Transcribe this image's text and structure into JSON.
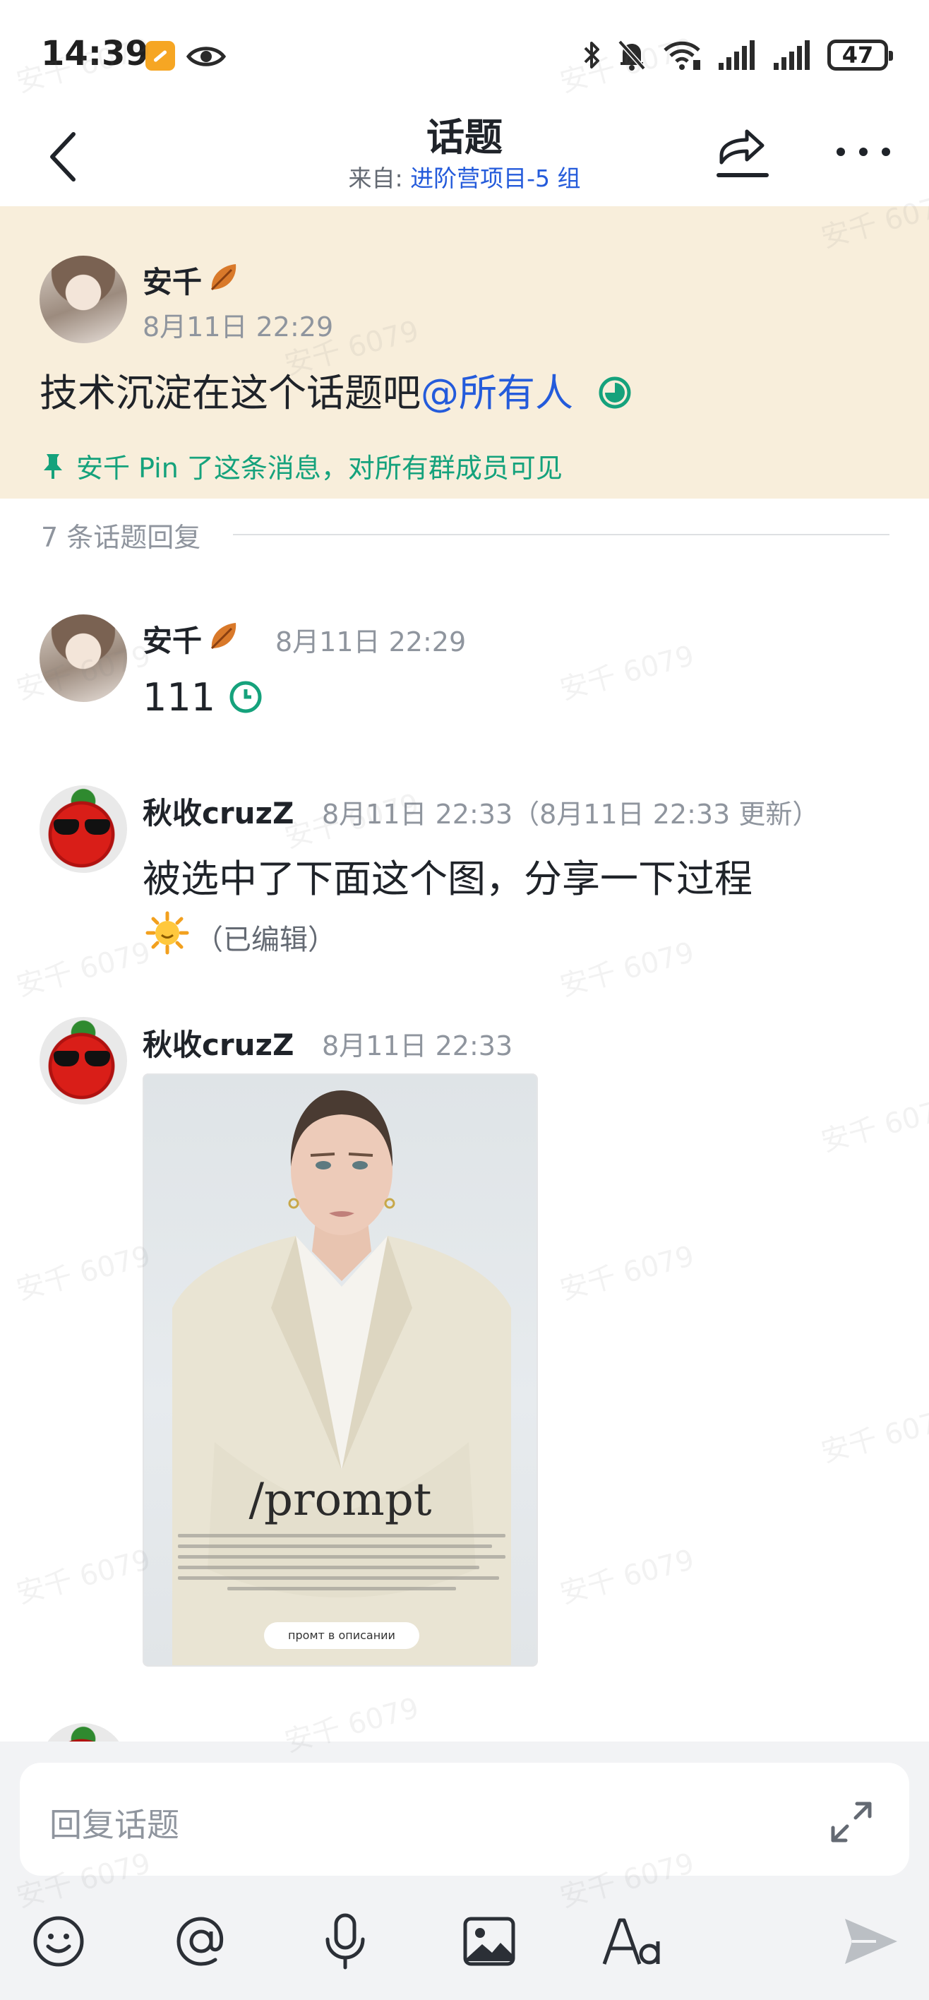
{
  "status_bar": {
    "time": "14:39",
    "battery": "47"
  },
  "header": {
    "title": "话题",
    "subtitle_prefix": "来自: ",
    "subtitle_group": "进阶营项目-5 组"
  },
  "pinned_message": {
    "author": "安千",
    "time": "8月11日 22:29",
    "text": "技术沉淀在这个话题吧",
    "mention": "@所有人",
    "pin_note": "安千 Pin 了这条消息，对所有群成员可见"
  },
  "replies_header": "7 条话题回复",
  "replies": [
    {
      "author": "安千",
      "time": "8月11日 22:29",
      "text": "111"
    },
    {
      "author": "秋收cruzZ",
      "time": "8月11日 22:33（8月11日 22:33 更新）",
      "text": "被选中了下面这个图，分享一下过程",
      "edited": "（已编辑）"
    },
    {
      "author": "秋收cruzZ",
      "time": "8月11日 22:33",
      "image_caption": "/prompt",
      "image_button": "промт в описании"
    }
  ],
  "composer": {
    "placeholder": "回复话题"
  },
  "watermark": "安千 6079",
  "colors": {
    "accent_green": "#15a27c",
    "link_blue": "#245bdb",
    "pinned_bg": "#f8eedb"
  }
}
